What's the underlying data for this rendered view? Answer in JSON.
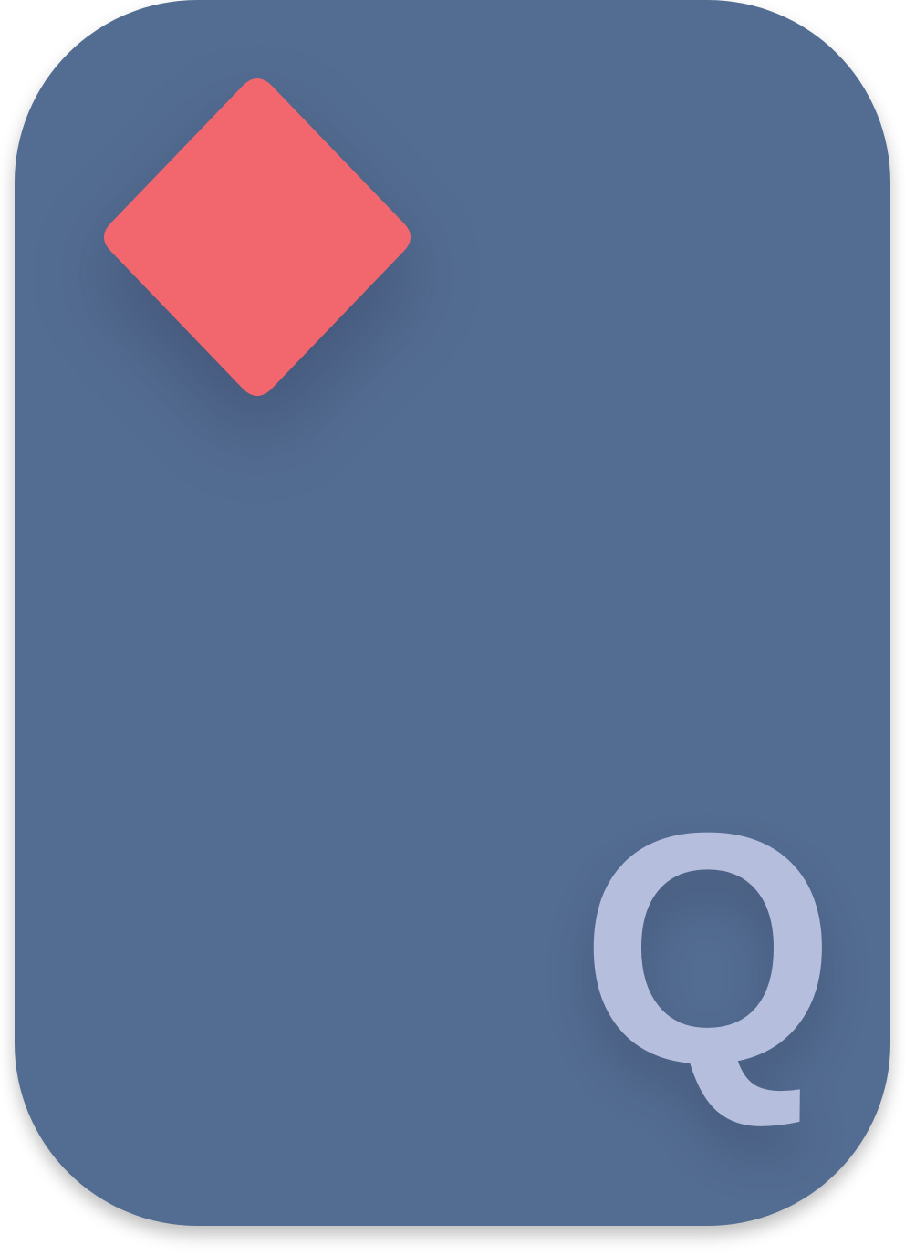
{
  "card": {
    "rank": "Q",
    "suit": "diamond-icon",
    "colors": {
      "background": "#536c91",
      "suit": "#f1676d",
      "rank": "#b5bedd"
    }
  }
}
